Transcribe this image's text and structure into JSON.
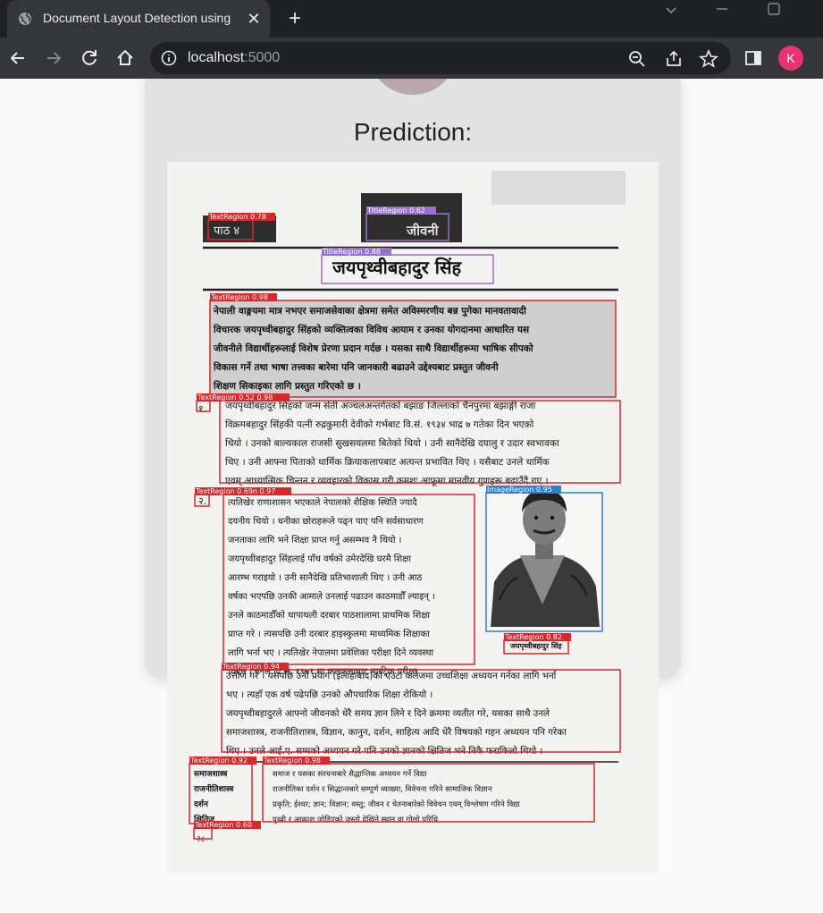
{
  "browser": {
    "tab_title": "Document Layout Detection using",
    "tab_close_glyph": "✕",
    "new_tab_glyph": "+",
    "url_host": "localhost",
    "url_port": ":5000",
    "avatar_letter": "K"
  },
  "page": {
    "heading": "Prediction:"
  },
  "document": {
    "page_label": "पाठ ४",
    "title_banner": "जीवनी",
    "main_title": "जयपृथ्वीबहादुर सिंह",
    "intro_lines": [
      "नेपाली वाङ्मयमा मात्र नभएर समाजसेवाका क्षेत्रमा समेत अविस्मरणीय बन्न पुगेका मानवतावादी",
      "विचारक जयपृथ्वीबहादुर सिंहको व्यक्तित्वका विविध आयाम र उनका योगदानमा आधारित यस",
      "जीवनीले विद्यार्थीहरूलाई विशेष प्रेरणा प्रदान गर्दछ । यसका साथै विद्यार्थीहरूमा भाषिक सीपको",
      "विकास गर्ने तथा भाषा तत्त्वका बारेमा पनि जानकारी बढाउने उद्देश्यबाट प्रस्तुत जीवनी",
      "शिक्षण सिकाइका लागि प्रस्तुत गरिएको छ ।"
    ],
    "para1_marker": "१.",
    "para1_lines": [
      "जयपृथ्वीबहादुर सिंहको जन्म सेती अञ्चलअन्तर्गतको बझाङ जिल्लाको चैनपुरमा बझाङ्गी राजा",
      "विक्रमबहादुर सिंहकी पत्नी रुद्रकुमारी देवीको गर्भबाट वि.सं. १९३४ भाद्र ७ गतेका दिन भएको",
      "थियो । उनको बाल्यकाल राजसी सुखसयलमा बितेको थियो । उनी सानैदेखि दयालु र उदार स्वभावका",
      "थिए । उनी आफ्ना पिताको धार्मिक क्रियाकलापबाट अत्यन्त प्रभावित थिए । यसैबाट उनले धार्मिक",
      "एवम् आध्यात्मिक चिन्तन र व्यवहारको विकास गरी क्रमशः आफूमा मानवीय गुणहरू बढाउँदै गए ।"
    ],
    "para2_marker": "२.",
    "para2_lines": [
      "त्यतिखेर राणाशासन भएकाले नेपालको शैक्षिक स्थिति ज्यादै",
      "दयनीय थियो । धनीका छोराहरूले पढ्न पाए पनि सर्वसाधारण",
      "जनताका लागि भने शिक्षा प्राप्त गर्नु असम्भव नै थियो ।",
      "जयपृथ्वीबहादुर सिंहलाई पाँच वर्षको उमेरदेखि घरमै शिक्षा",
      "आरम्भ गराइयो । उनी सानैदेखि प्रतिभाशाली थिए । उनी आठ",
      "वर्षका भएपछि उनकी आमाले उनलाई पढाउन काठमाडौँ ल्याइन् ।",
      "उनले काठमाडौँको थापाथली दरबार पाठशालामा प्राथमिक शिक्षा",
      "प्राप्त गरे । त्यसपछि उनी दरबार हाइस्कुलमा माध्यमिक शिक्षाका",
      "लागि भर्ना भए । त्यतिखेर नेपालमा प्रवेशिका परीक्षा दिने व्यवस्था",
      "थिएन । उनले वि.सं. १९५१ मा कलकत्ताबाट म्याट्रिक परीक्षा"
    ],
    "portrait_caption": "जयपृथ्वीबहादुर सिंह",
    "para3_lines": [
      "उत्तीर्ण गरे । यसपछि उनी प्रयाग (इलाहाबाद)को एउटा कलेजमा उच्चशिक्षा अध्ययन गर्नका लागि भर्ना",
      "भए । त्यहाँ एक वर्ष पढेपछि उनको औपचारिक शिक्षा रोकियो ।",
      "जयपृथ्वीबहादुरले आफ्नो जीवनको धेरै समय ज्ञान लिने र दिने क्रममा व्यतीत गरे, यसका साथै उनले",
      "समाजशास्त्र, राजनीतिशास्त्र, विज्ञान, कानुन, दर्शन, साहित्य आदि धेरै विषयको गहन अध्ययन पनि गरेका",
      "थिए । उनले आई.ए. सम्मको अध्ययन गरे पनि उनको ज्ञानको क्षितिज भने निकै फराकिलो थियो ।"
    ],
    "glossary_terms": [
      "समाजशास्त्र",
      "राजनीतिशास्त्र",
      "दर्शन",
      "क्षितिज"
    ],
    "glossary_defs": [
      "समाज र यसका संरचनाबारे सैद्धान्तिक अध्ययन गर्ने विद्या",
      "राजनीतिका दर्शन र सिद्धान्तबारे सम्पूर्ण व्याख्या, विवेचना गरिने सामाजिक विज्ञान",
      "प्रकृति; ईश्वर; ज्ञान; विज्ञान; वस्तु; जीवन र चेतनाबारेको विवेचन एवम् विश्लेषण गरिने विद्या",
      "पृथ्वी र आकाश जोडिएको जस्तो देखिने स्थान वा गोलो परिधि"
    ],
    "page_number": "२८"
  },
  "detections": {
    "text_region_78": "TextRegion  0.78",
    "title_region_62": "TitleRegion  0.62",
    "title_region_88": "TitleRegion  0.88",
    "text_region_98a": "TextRegion  0.98",
    "text_region_52_98": "TextRegion  0.52  0.98",
    "text_region_69_97": "TextRegion  0.69n  0.97",
    "image_region_95": "ImageRegion  0.95",
    "text_region_82": "TextRegion  0.82",
    "text_region_94": "TextRegion  0.94",
    "text_region_92": "TextRegion  0.92",
    "text_region_98b": "TextRegion  0.98",
    "text_region_60": "TextRegion  0.60"
  },
  "colors": {
    "text_box": "#d8282c",
    "title_box": "#9b6fd1",
    "image_box": "#2e7fd0"
  }
}
